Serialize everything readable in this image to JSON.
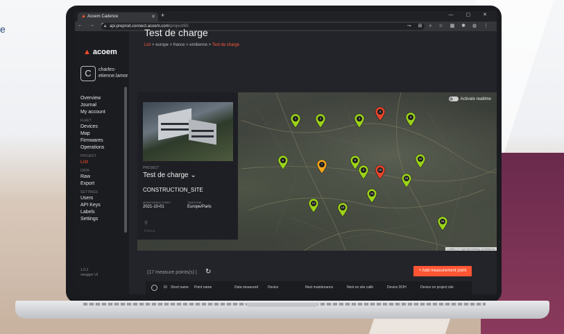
{
  "backdrop": {
    "fragment_text": "e"
  },
  "browser": {
    "tab_title": "Acoem Cadence",
    "new_tab_glyph": "+",
    "window_controls": "— ▢ ✕",
    "nav_glyphs": "← → C",
    "url_host": "api.preprod.connect.acoem.com",
    "url_path": "/project/65",
    "toolbar_glyphs": "⊸ ⊞ ⌕ ☆ ▦ ✱ ◍ ⋮"
  },
  "sidebar": {
    "logo": "acoem",
    "avatar_initial": "C",
    "username": "charles-etienne.lamor",
    "groups": [
      {
        "category": "",
        "items": [
          {
            "label": "Overview"
          },
          {
            "label": "Journal"
          },
          {
            "label": "My account"
          }
        ]
      },
      {
        "category": "FLEET",
        "items": [
          {
            "label": "Devices"
          },
          {
            "label": "Map"
          },
          {
            "label": "Firmwares"
          },
          {
            "label": "Operations"
          }
        ]
      },
      {
        "category": "PROJECT",
        "items": [
          {
            "label": "List"
          }
        ]
      },
      {
        "category": "DATA",
        "items": [
          {
            "label": "Raw"
          },
          {
            "label": "Export"
          }
        ]
      },
      {
        "category": "SETTINGS",
        "items": [
          {
            "label": "Users"
          },
          {
            "label": "API Keys"
          },
          {
            "label": "Labels"
          },
          {
            "label": "Settings"
          }
        ]
      }
    ],
    "version": "1.0.3",
    "swagger": "swagger UI"
  },
  "main": {
    "title": "Test de charge",
    "breadcrumb": {
      "root": "List",
      "sep": ">",
      "items": [
        "europe",
        "france",
        "emilienne"
      ],
      "current": "Test de charge"
    }
  },
  "map": {
    "realtime_label": "Activate realtime",
    "attribution": "Leaflet | © OpenStreetMap contributors",
    "markers": [
      {
        "n": "1",
        "status": "ok"
      },
      {
        "n": "2",
        "status": "ok"
      },
      {
        "n": "3",
        "status": "ok"
      },
      {
        "n": "4",
        "status": "alarm"
      },
      {
        "n": "5",
        "status": "ok"
      },
      {
        "n": "6",
        "status": "ok"
      },
      {
        "n": "7",
        "status": "warning"
      },
      {
        "n": "8",
        "status": "ok"
      },
      {
        "n": "9",
        "status": "ok"
      },
      {
        "n": "10",
        "status": "alarm"
      },
      {
        "n": "11",
        "status": "ok"
      },
      {
        "n": "12",
        "status": "ok"
      },
      {
        "n": "13",
        "status": "ok"
      },
      {
        "n": "14",
        "status": "ok"
      },
      {
        "n": "15",
        "status": "ok"
      },
      {
        "n": "16",
        "status": "ok"
      }
    ],
    "colors": {
      "ok": "#9bd21a",
      "warning": "#f2a51a",
      "alarm": "#e8442a"
    }
  },
  "project": {
    "label": "PROJECT",
    "name": "Test de charge",
    "type": "CONSTRUCTION_SITE",
    "monitoring_label": "MONITORING START:",
    "monitoring_value": "2021-10-01",
    "timezone_label": "TIMEZONE:",
    "timezone_value": "Europe/Paris",
    "country": "France"
  },
  "measure": {
    "count_text": "(17 measure points(s)",
    "separator": "|",
    "add_button": "+ Add measurement point",
    "columns": [
      "ID",
      "Short name",
      "Point name",
      "Data measured",
      "Device",
      "Next maintenance",
      "Next on site calib",
      "Device DOH",
      "Device on project site"
    ]
  },
  "accent_color": "#ff4a2b"
}
